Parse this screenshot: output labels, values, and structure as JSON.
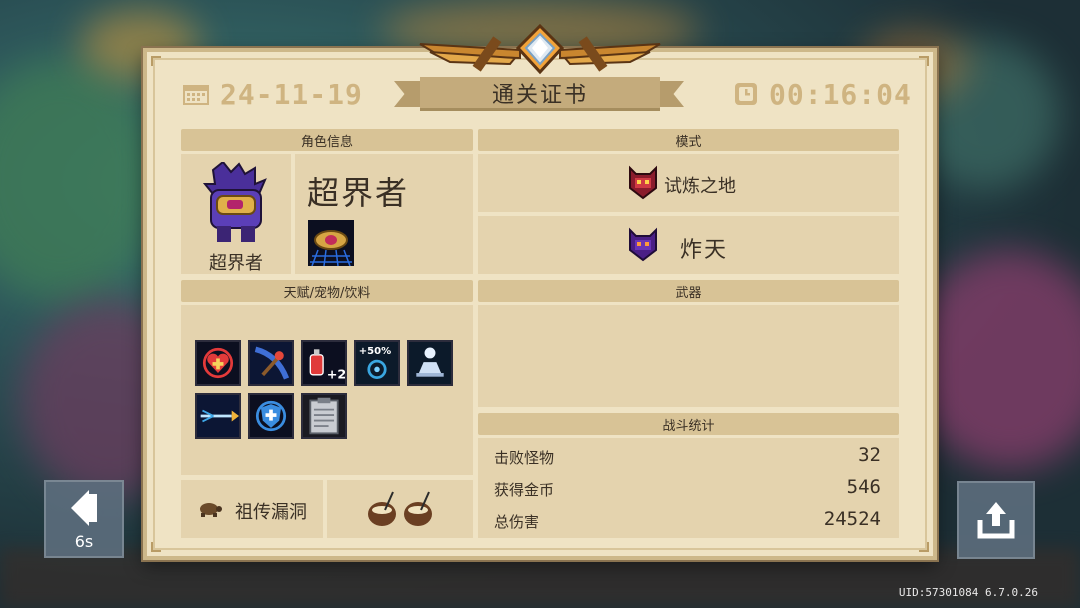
{
  "header": {
    "date": "24-11-19",
    "title": "通关证书",
    "time": "00:16:04"
  },
  "character": {
    "section_title": "角色信息",
    "name": "超界者",
    "portrait_caption": "超界者"
  },
  "mode": {
    "section_title": "模式",
    "mode_name": "试炼之地",
    "difficulty": "炸天"
  },
  "talents": {
    "section_title": "天赋/宠物/饮料",
    "icons": [
      "heart-plus-icon",
      "meteor-staff-icon",
      "potion-plus-two-icon",
      "plus-fifty-percent-icon",
      "meditation-icon",
      "fire-arrow-icon",
      "shield-plus-icon",
      "notebook-icon"
    ],
    "badge_text": "+50%",
    "potion_badge": "+2"
  },
  "pet": {
    "label": "祖传漏洞"
  },
  "weapons": {
    "section_title": "武器"
  },
  "stats": {
    "section_title": "战斗统计",
    "rows": [
      {
        "label": "击败怪物",
        "value": "32"
      },
      {
        "label": "获得金币",
        "value": "546"
      },
      {
        "label": "总伤害",
        "value": "24524"
      }
    ]
  },
  "controls": {
    "back_countdown": "6s"
  },
  "footer": {
    "uid": "UID:57301084 6.7.0.26"
  },
  "colors": {
    "card_bg": "#efe3c4",
    "panel_bg": "#e4d3ae",
    "accent_gold": "#cfb481",
    "text_dark": "#3a3025"
  }
}
